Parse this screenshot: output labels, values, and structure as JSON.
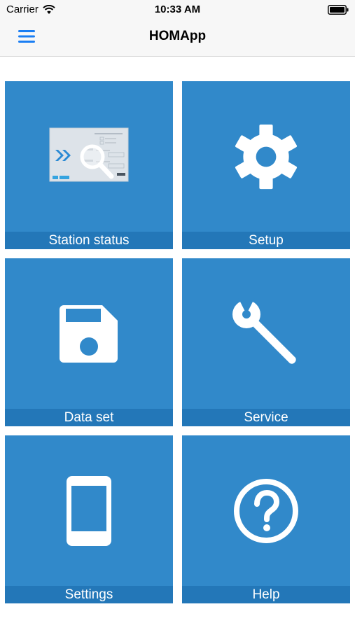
{
  "status_bar": {
    "carrier": "Carrier",
    "time": "10:33 AM"
  },
  "nav": {
    "title": "HOMApp",
    "menu_icon": "hamburger-menu-icon"
  },
  "tiles": [
    {
      "label": "Station status",
      "icon": "station-status-icon"
    },
    {
      "label": "Setup",
      "icon": "gear-icon"
    },
    {
      "label": "Data set",
      "icon": "floppy-disk-icon"
    },
    {
      "label": "Service",
      "icon": "wrench-icon"
    },
    {
      "label": "Settings",
      "icon": "smartphone-icon"
    },
    {
      "label": "Help",
      "icon": "question-circle-icon"
    }
  ],
  "colors": {
    "tile": "#3189ca",
    "label_bar": "#2377b8",
    "accent": "#1a7ef3"
  }
}
